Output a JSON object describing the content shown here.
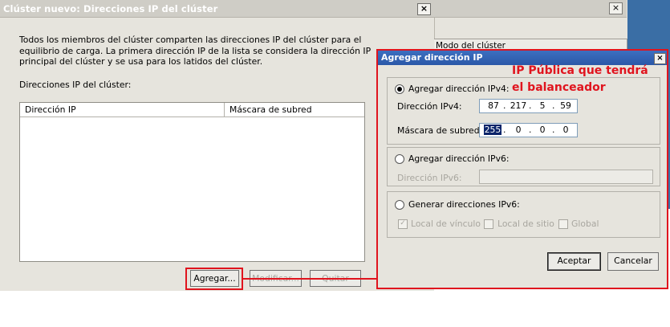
{
  "main_dialog": {
    "title": "Clúster nuevo: Direcciones IP del clúster",
    "close_glyph": "×",
    "description": "Todos los miembros del clúster comparten las direcciones IP del clúster para el equilibrio de carga. La primera dirección IP de la lista se considera la dirección IP principal del clúster y se usa para los latidos del clúster.",
    "list_label": "Direcciones IP del clúster:",
    "columns": [
      "Dirección IP",
      "Máscara de subred"
    ],
    "buttons": {
      "add": "Agregar...",
      "modify": "Modificar...",
      "remove": "Quitar"
    }
  },
  "background_window": {
    "close_glyph": "×",
    "tab_label": "Modo del clúster"
  },
  "annotation": {
    "line1": "IP Pública que tendrá",
    "line2": "el balanceador",
    "color": "#e0141e"
  },
  "add_ip_dialog": {
    "title": "Agregar dirección IP",
    "close_glyph": "×",
    "ipv4_option": "Agregar dirección IPv4:",
    "ipv4_address_label": "Dirección IPv4:",
    "ipv4_address": [
      "87",
      "217",
      "5",
      "59"
    ],
    "subnet_label": "Máscara de subred:",
    "subnet_mask": [
      "255",
      "0",
      "0",
      "0"
    ],
    "ipv6_option": "Agregar dirección IPv6:",
    "ipv6_address_label": "Dirección IPv6:",
    "generate_ipv6_option": "Generar direcciones IPv6:",
    "checkboxes": {
      "link_local": "Local de vínculo",
      "site_local": "Local de sitio",
      "global": "Global"
    },
    "ok_button": "Aceptar",
    "cancel_button": "Cancelar"
  },
  "colors": {
    "title_active": "#2b58a8",
    "annotation_red": "#e0141e",
    "dialog_bg": "#e6e4dd"
  }
}
